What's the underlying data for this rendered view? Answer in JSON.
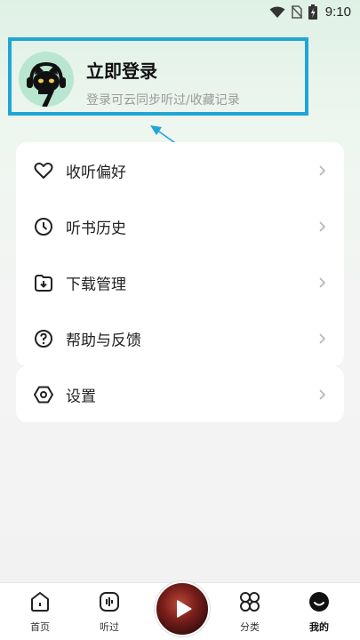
{
  "status_bar": {
    "time": "9:10",
    "icons": [
      "wifi-icon",
      "no-sim-icon",
      "battery-icon"
    ]
  },
  "login": {
    "title": "立即登录",
    "subtitle": "登录可云同步听过/收藏记录"
  },
  "menu": {
    "group1": [
      {
        "label": "收听偏好",
        "icon": "heart-icon"
      },
      {
        "label": "听书历史",
        "icon": "clock-icon"
      },
      {
        "label": "下载管理",
        "icon": "download-icon"
      },
      {
        "label": "帮助与反馈",
        "icon": "help-icon"
      }
    ],
    "group2": [
      {
        "label": "设置",
        "icon": "settings-icon"
      }
    ]
  },
  "bottom_nav": {
    "items": [
      {
        "label": "首页",
        "icon": "home-icon"
      },
      {
        "label": "听过",
        "icon": "audio-icon"
      },
      {
        "label": "分类",
        "icon": "category-icon"
      },
      {
        "label": "我的",
        "icon": "profile-icon",
        "active": true
      }
    ],
    "center": {
      "icon": "play-icon"
    }
  },
  "colors": {
    "highlight": "#1fa6d6",
    "avatar_bg": "#b9e6d1"
  }
}
